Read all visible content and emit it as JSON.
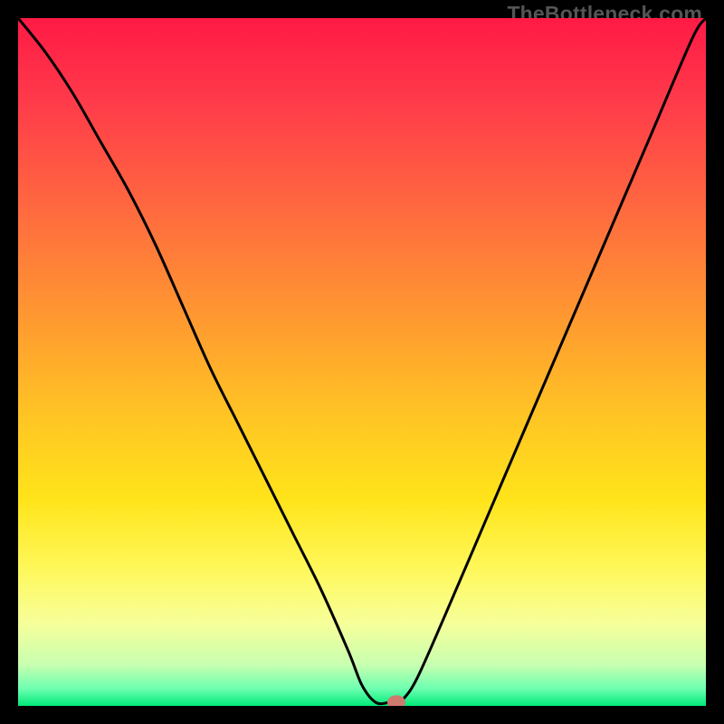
{
  "watermark": "TheBottleneck.com",
  "chart_data": {
    "type": "line",
    "title": "",
    "xlabel": "",
    "ylabel": "",
    "xlim": [
      0,
      100
    ],
    "ylim": [
      0,
      100
    ],
    "grid": false,
    "legend": false,
    "annotations": [
      {
        "label": "marker-dot",
        "x": 55,
        "y": 0.5
      }
    ],
    "series": [
      {
        "name": "bottleneck-curve",
        "x": [
          0,
          4,
          8,
          12,
          16,
          20,
          24,
          28,
          32,
          36,
          40,
          44,
          48,
          50,
          52,
          54,
          55,
          56,
          58,
          62,
          68,
          74,
          80,
          86,
          92,
          98,
          100
        ],
        "values": [
          100,
          95,
          89,
          82,
          75,
          67,
          58,
          49,
          41,
          33,
          25,
          17,
          8,
          3,
          0.5,
          0.5,
          0.5,
          1,
          4,
          13,
          27,
          41,
          55,
          69,
          83,
          97,
          100
        ]
      }
    ],
    "gradient_stops": [
      {
        "offset": 0.0,
        "color": "#ff1a45"
      },
      {
        "offset": 0.12,
        "color": "#ff3a4a"
      },
      {
        "offset": 0.28,
        "color": "#ff6a3f"
      },
      {
        "offset": 0.44,
        "color": "#ff9a30"
      },
      {
        "offset": 0.58,
        "color": "#ffc524"
      },
      {
        "offset": 0.7,
        "color": "#ffe41a"
      },
      {
        "offset": 0.8,
        "color": "#fff85a"
      },
      {
        "offset": 0.88,
        "color": "#f7ff9a"
      },
      {
        "offset": 0.94,
        "color": "#c8ffb0"
      },
      {
        "offset": 0.975,
        "color": "#6dffb0"
      },
      {
        "offset": 1.0,
        "color": "#00e978"
      }
    ],
    "marker": {
      "x": 55,
      "y": 0.5,
      "color": "#cf7a6f"
    }
  }
}
